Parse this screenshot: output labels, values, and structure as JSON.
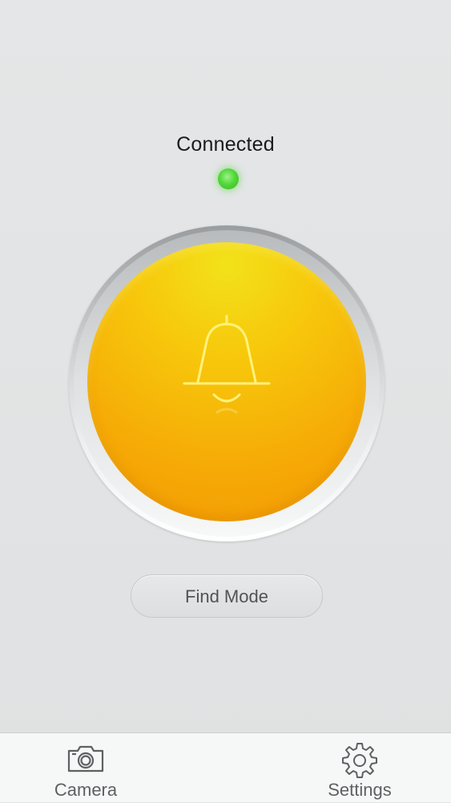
{
  "status": {
    "label": "Connected",
    "indicator_color": "#4fd63a"
  },
  "alarm_button": {
    "icon": "bell-icon",
    "color": "#f6b008"
  },
  "find_mode_button": {
    "label": "Find Mode"
  },
  "tab_bar": {
    "items": [
      {
        "label": "Camera",
        "icon": "camera-icon"
      },
      {
        "label": "Settings",
        "icon": "gear-icon"
      }
    ]
  }
}
